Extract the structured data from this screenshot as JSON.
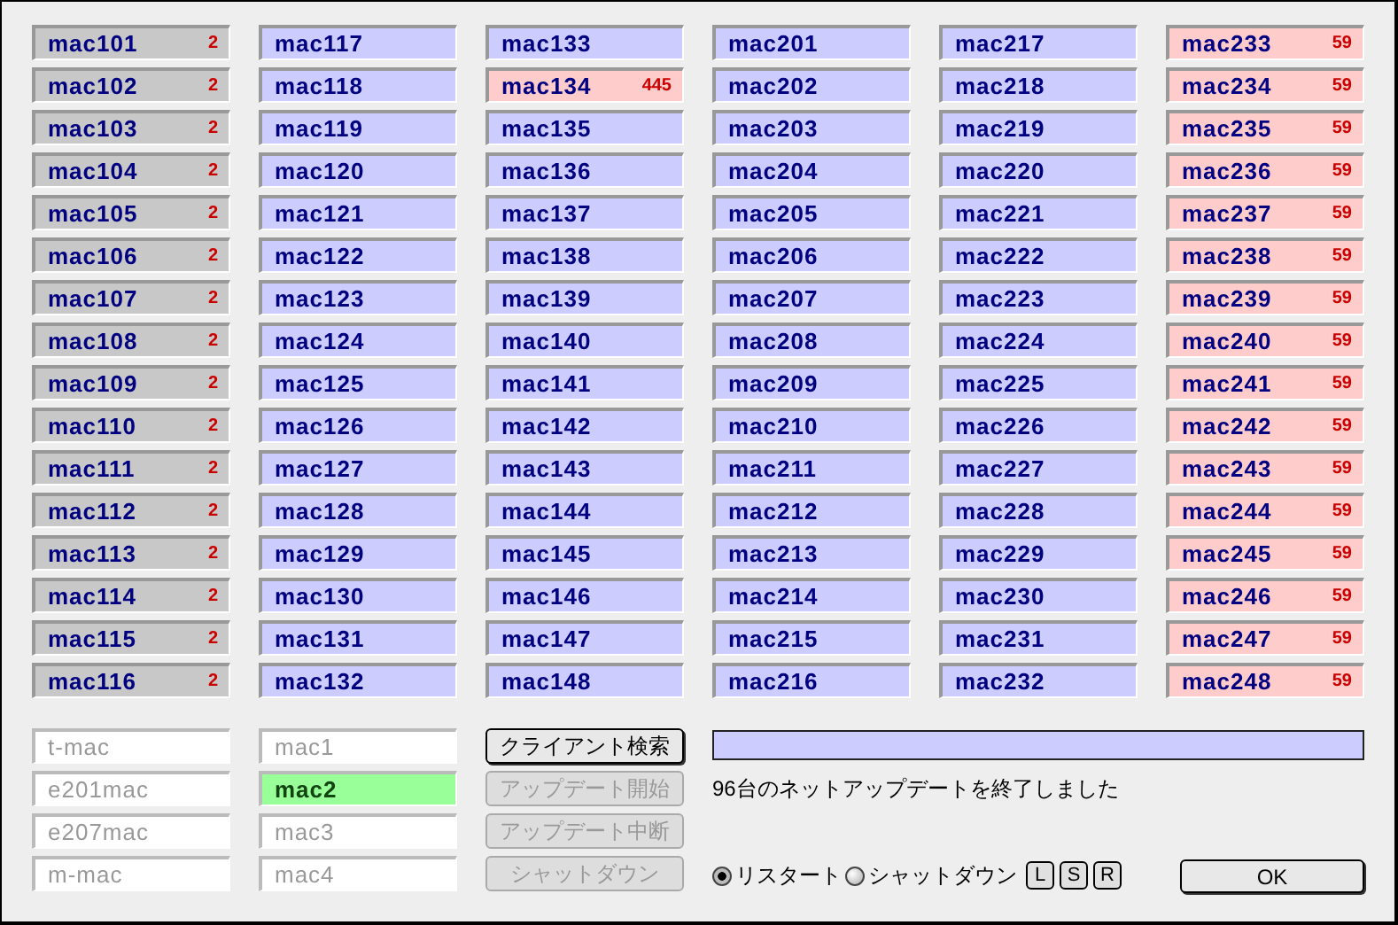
{
  "machine_columns": [
    {
      "machines": [
        {
          "name": "mac101",
          "count": "2",
          "color": "#c8c8c8"
        },
        {
          "name": "mac102",
          "count": "2",
          "color": "#c8c8c8"
        },
        {
          "name": "mac103",
          "count": "2",
          "color": "#c8c8c8"
        },
        {
          "name": "mac104",
          "count": "2",
          "color": "#c8c8c8"
        },
        {
          "name": "mac105",
          "count": "2",
          "color": "#c8c8c8"
        },
        {
          "name": "mac106",
          "count": "2",
          "color": "#c8c8c8"
        },
        {
          "name": "mac107",
          "count": "2",
          "color": "#c8c8c8"
        },
        {
          "name": "mac108",
          "count": "2",
          "color": "#c8c8c8"
        },
        {
          "name": "mac109",
          "count": "2",
          "color": "#c8c8c8"
        },
        {
          "name": "mac110",
          "count": "2",
          "color": "#c8c8c8"
        },
        {
          "name": "mac111",
          "count": "2",
          "color": "#c8c8c8"
        },
        {
          "name": "mac112",
          "count": "2",
          "color": "#c8c8c8"
        },
        {
          "name": "mac113",
          "count": "2",
          "color": "#c8c8c8"
        },
        {
          "name": "mac114",
          "count": "2",
          "color": "#c8c8c8"
        },
        {
          "name": "mac115",
          "count": "2",
          "color": "#c8c8c8"
        },
        {
          "name": "mac116",
          "count": "2",
          "color": "#c8c8c8"
        }
      ]
    },
    {
      "machines": [
        {
          "name": "mac117",
          "color": "#ccccff"
        },
        {
          "name": "mac118",
          "color": "#ccccff"
        },
        {
          "name": "mac119",
          "color": "#ccccff"
        },
        {
          "name": "mac120",
          "color": "#ccccff"
        },
        {
          "name": "mac121",
          "color": "#ccccff"
        },
        {
          "name": "mac122",
          "color": "#ccccff"
        },
        {
          "name": "mac123",
          "color": "#ccccff"
        },
        {
          "name": "mac124",
          "color": "#ccccff"
        },
        {
          "name": "mac125",
          "color": "#ccccff"
        },
        {
          "name": "mac126",
          "color": "#ccccff"
        },
        {
          "name": "mac127",
          "color": "#ccccff"
        },
        {
          "name": "mac128",
          "color": "#ccccff"
        },
        {
          "name": "mac129",
          "color": "#ccccff"
        },
        {
          "name": "mac130",
          "color": "#ccccff"
        },
        {
          "name": "mac131",
          "color": "#ccccff"
        },
        {
          "name": "mac132",
          "color": "#ccccff"
        }
      ]
    },
    {
      "machines": [
        {
          "name": "mac133",
          "color": "#ccccff"
        },
        {
          "name": "mac134",
          "count": "445",
          "color": "#ffcccc"
        },
        {
          "name": "mac135",
          "color": "#ccccff"
        },
        {
          "name": "mac136",
          "color": "#ccccff"
        },
        {
          "name": "mac137",
          "color": "#ccccff"
        },
        {
          "name": "mac138",
          "color": "#ccccff"
        },
        {
          "name": "mac139",
          "color": "#ccccff"
        },
        {
          "name": "mac140",
          "color": "#ccccff"
        },
        {
          "name": "mac141",
          "color": "#ccccff"
        },
        {
          "name": "mac142",
          "color": "#ccccff"
        },
        {
          "name": "mac143",
          "color": "#ccccff"
        },
        {
          "name": "mac144",
          "color": "#ccccff"
        },
        {
          "name": "mac145",
          "color": "#ccccff"
        },
        {
          "name": "mac146",
          "color": "#ccccff"
        },
        {
          "name": "mac147",
          "color": "#ccccff"
        },
        {
          "name": "mac148",
          "color": "#ccccff"
        }
      ]
    },
    {
      "machines": [
        {
          "name": "mac201",
          "color": "#ccccff"
        },
        {
          "name": "mac202",
          "color": "#ccccff"
        },
        {
          "name": "mac203",
          "color": "#ccccff"
        },
        {
          "name": "mac204",
          "color": "#ccccff"
        },
        {
          "name": "mac205",
          "color": "#ccccff"
        },
        {
          "name": "mac206",
          "color": "#ccccff"
        },
        {
          "name": "mac207",
          "color": "#ccccff"
        },
        {
          "name": "mac208",
          "color": "#ccccff"
        },
        {
          "name": "mac209",
          "color": "#ccccff"
        },
        {
          "name": "mac210",
          "color": "#ccccff"
        },
        {
          "name": "mac211",
          "color": "#ccccff"
        },
        {
          "name": "mac212",
          "color": "#ccccff"
        },
        {
          "name": "mac213",
          "color": "#ccccff"
        },
        {
          "name": "mac214",
          "color": "#ccccff"
        },
        {
          "name": "mac215",
          "color": "#ccccff"
        },
        {
          "name": "mac216",
          "color": "#ccccff"
        }
      ]
    },
    {
      "machines": [
        {
          "name": "mac217",
          "color": "#ccccff"
        },
        {
          "name": "mac218",
          "color": "#ccccff"
        },
        {
          "name": "mac219",
          "color": "#ccccff"
        },
        {
          "name": "mac220",
          "color": "#ccccff"
        },
        {
          "name": "mac221",
          "color": "#ccccff"
        },
        {
          "name": "mac222",
          "color": "#ccccff"
        },
        {
          "name": "mac223",
          "color": "#ccccff"
        },
        {
          "name": "mac224",
          "color": "#ccccff"
        },
        {
          "name": "mac225",
          "color": "#ccccff"
        },
        {
          "name": "mac226",
          "color": "#ccccff"
        },
        {
          "name": "mac227",
          "color": "#ccccff"
        },
        {
          "name": "mac228",
          "color": "#ccccff"
        },
        {
          "name": "mac229",
          "color": "#ccccff"
        },
        {
          "name": "mac230",
          "color": "#ccccff"
        },
        {
          "name": "mac231",
          "color": "#ccccff"
        },
        {
          "name": "mac232",
          "color": "#ccccff"
        }
      ]
    },
    {
      "machines": [
        {
          "name": "mac233",
          "count": "59",
          "color": "#ffcccc"
        },
        {
          "name": "mac234",
          "count": "59",
          "color": "#ffcccc"
        },
        {
          "name": "mac235",
          "count": "59",
          "color": "#ffcccc"
        },
        {
          "name": "mac236",
          "count": "59",
          "color": "#ffcccc"
        },
        {
          "name": "mac237",
          "count": "59",
          "color": "#ffcccc"
        },
        {
          "name": "mac238",
          "count": "59",
          "color": "#ffcccc"
        },
        {
          "name": "mac239",
          "count": "59",
          "color": "#ffcccc"
        },
        {
          "name": "mac240",
          "count": "59",
          "color": "#ffcccc"
        },
        {
          "name": "mac241",
          "count": "59",
          "color": "#ffcccc"
        },
        {
          "name": "mac242",
          "count": "59",
          "color": "#ffcccc"
        },
        {
          "name": "mac243",
          "count": "59",
          "color": "#ffcccc"
        },
        {
          "name": "mac244",
          "count": "59",
          "color": "#ffcccc"
        },
        {
          "name": "mac245",
          "count": "59",
          "color": "#ffcccc"
        },
        {
          "name": "mac246",
          "count": "59",
          "color": "#ffcccc"
        },
        {
          "name": "mac247",
          "count": "59",
          "color": "#ffcccc"
        },
        {
          "name": "mac248",
          "count": "59",
          "color": "#ffcccc"
        }
      ]
    }
  ],
  "groups": [
    {
      "value": "t-mac"
    },
    {
      "value": "e201mac"
    },
    {
      "value": "e207mac"
    },
    {
      "value": "m-mac"
    }
  ],
  "hosts": [
    {
      "value": "mac1",
      "selected": false
    },
    {
      "value": "mac2",
      "selected": true
    },
    {
      "value": "mac3",
      "selected": false
    },
    {
      "value": "mac4",
      "selected": false
    }
  ],
  "actions": [
    {
      "label": "クライアント検索",
      "disabled": false
    },
    {
      "label": "アップデート開始",
      "disabled": true
    },
    {
      "label": "アップデート中断",
      "disabled": true
    },
    {
      "label": "シャットダウン",
      "disabled": true
    }
  ],
  "progress": {
    "level": 1
  },
  "status_text": "96台のネットアップデートを終了しました",
  "after_update": [
    {
      "label": "リスタート",
      "selected": true
    },
    {
      "label": "シャットダウン",
      "selected": false
    }
  ],
  "mode_buttons": [
    "L",
    "S",
    "R"
  ],
  "ok_button": "OK"
}
